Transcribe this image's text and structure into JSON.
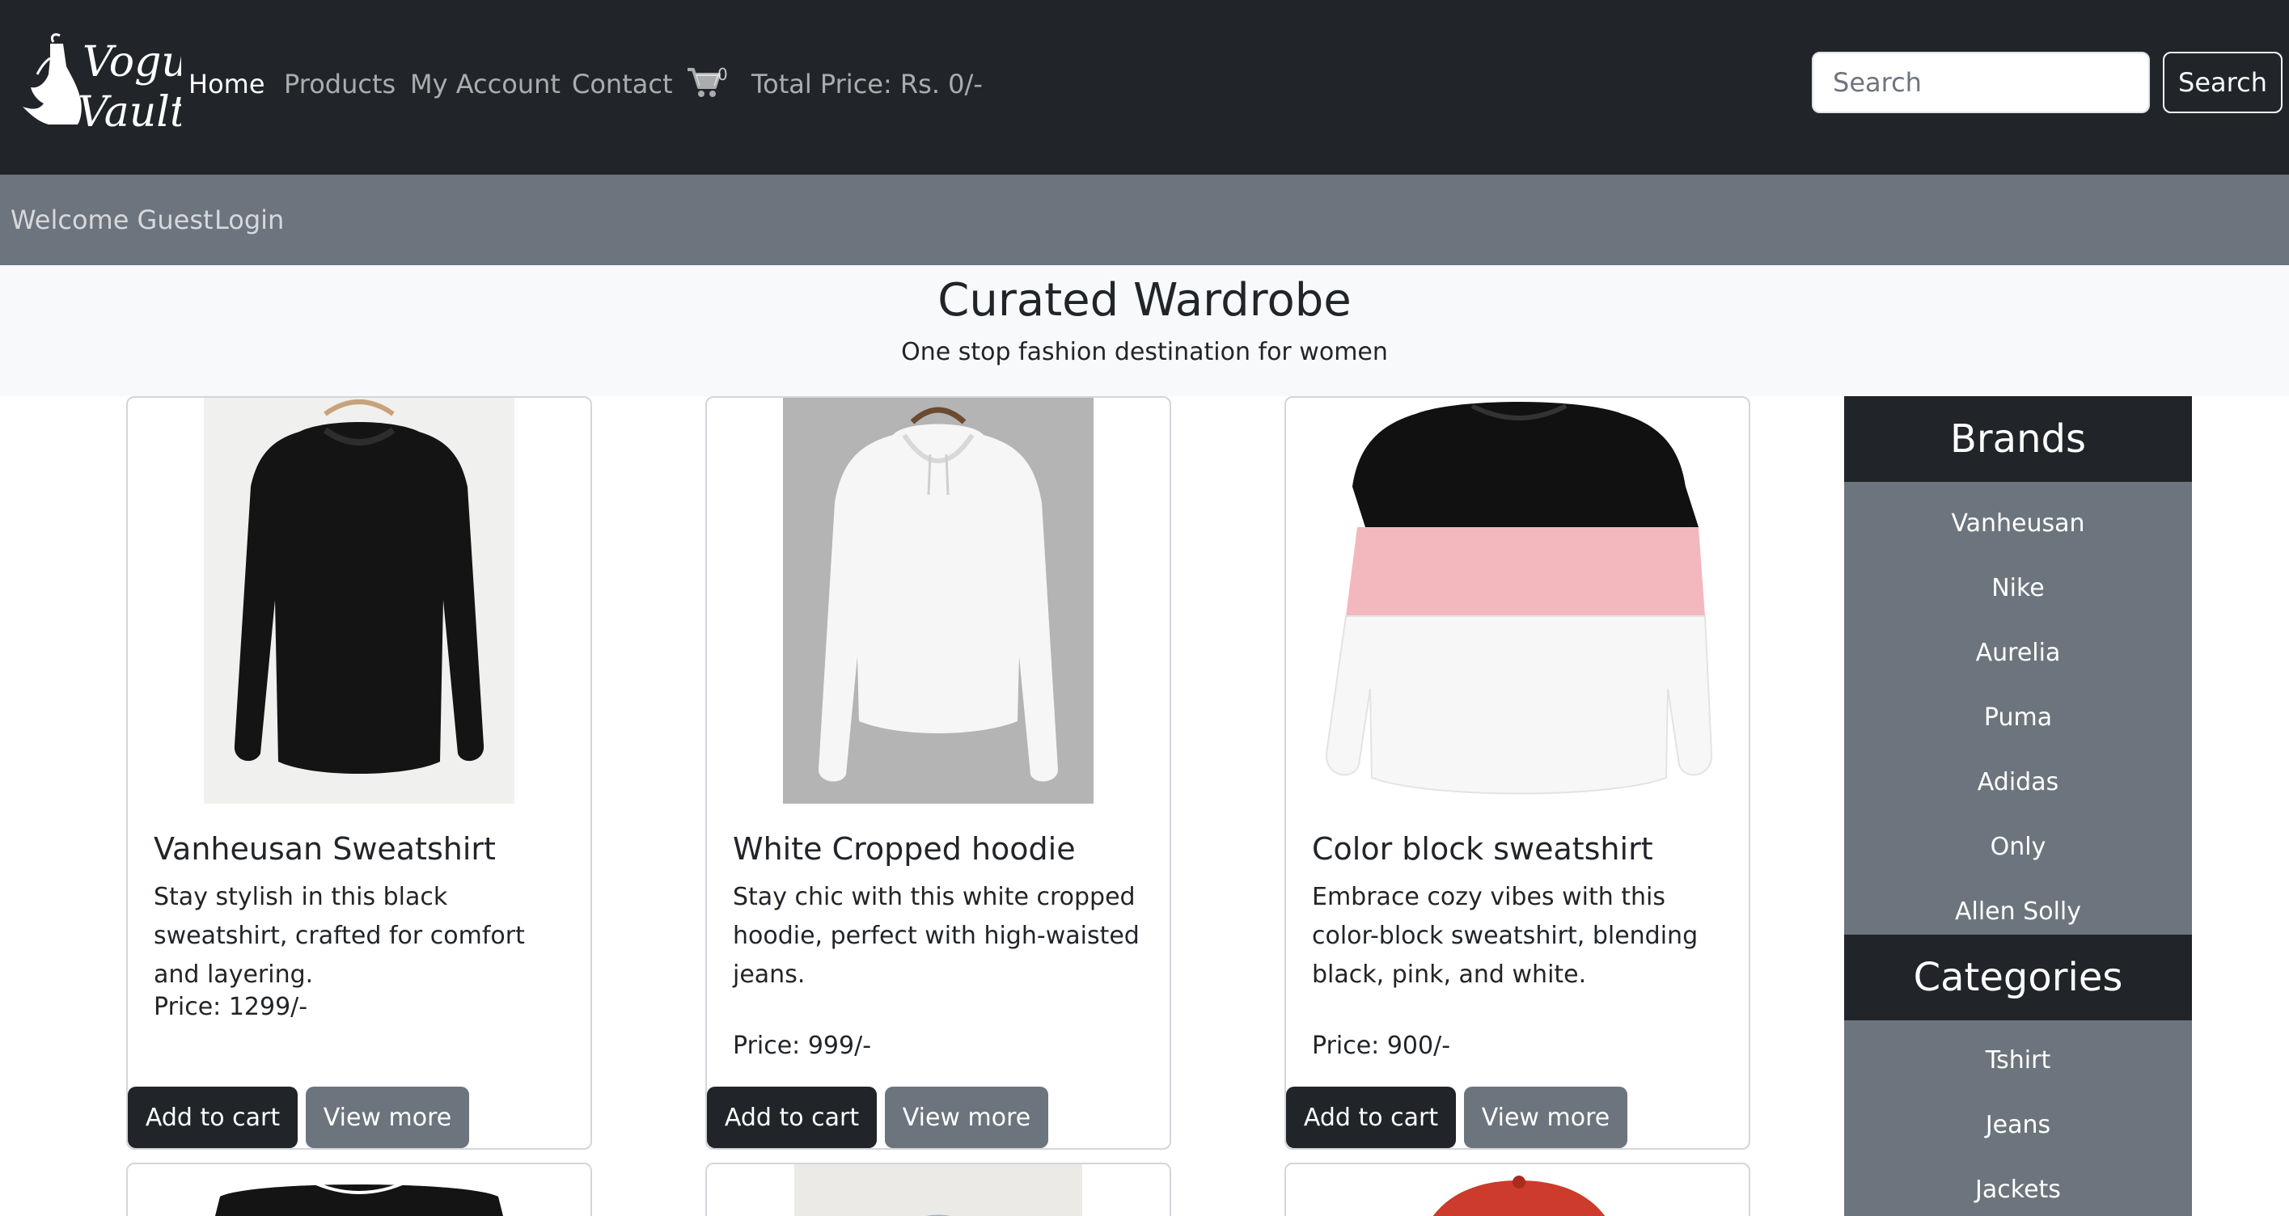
{
  "brand": {
    "logo_text": "Vogue Vault"
  },
  "nav": {
    "home": "Home",
    "products": "Products",
    "account": "My Account",
    "contact": "Contact",
    "cart_icon": "shopping-cart-icon",
    "cart_count": "0",
    "total_price": "Total Price: Rs. 0/-"
  },
  "search": {
    "placeholder": "Search",
    "value": "",
    "button_label": "Search"
  },
  "welcome": {
    "greeting": "Welcome Guest",
    "login": "Login"
  },
  "hero": {
    "title": "Curated Wardrobe",
    "subtitle": "One stop fashion destination for women"
  },
  "products": [
    {
      "title": "Vanheusan Sweatshirt",
      "description": "Stay stylish in this black sweatshirt, crafted for comfort and layering.",
      "price": "Price: 1299/-",
      "add_label": "Add to cart",
      "view_label": "View more"
    },
    {
      "title": "White Cropped hoodie",
      "description": "Stay chic with this white cropped hoodie, perfect with high-waisted jeans.",
      "price": "Price: 999/-",
      "add_label": "Add to cart",
      "view_label": "View more"
    },
    {
      "title": "Color block sweatshirt",
      "description": "Embrace cozy vibes with this color-block sweatshirt, blending black, pink, and white.",
      "price": "Price: 900/-",
      "add_label": "Add to cart",
      "view_label": "View more"
    }
  ],
  "sidebar": {
    "brands_title": "Brands",
    "brands": [
      "Vanheusan",
      "Nike",
      "Aurelia",
      "Puma",
      "Adidas",
      "Only",
      "Allen Solly"
    ],
    "categories_title": "Categories",
    "categories": [
      "Tshirt",
      "Jeans",
      "Jackets"
    ]
  },
  "colors": {
    "navbar": "#212529",
    "subbar": "#6c757d",
    "hero_bg": "#f8f9fa",
    "button_dark": "#212529",
    "button_gray": "#6c757d",
    "sweatshirt_pink": "#f2b8bd"
  }
}
